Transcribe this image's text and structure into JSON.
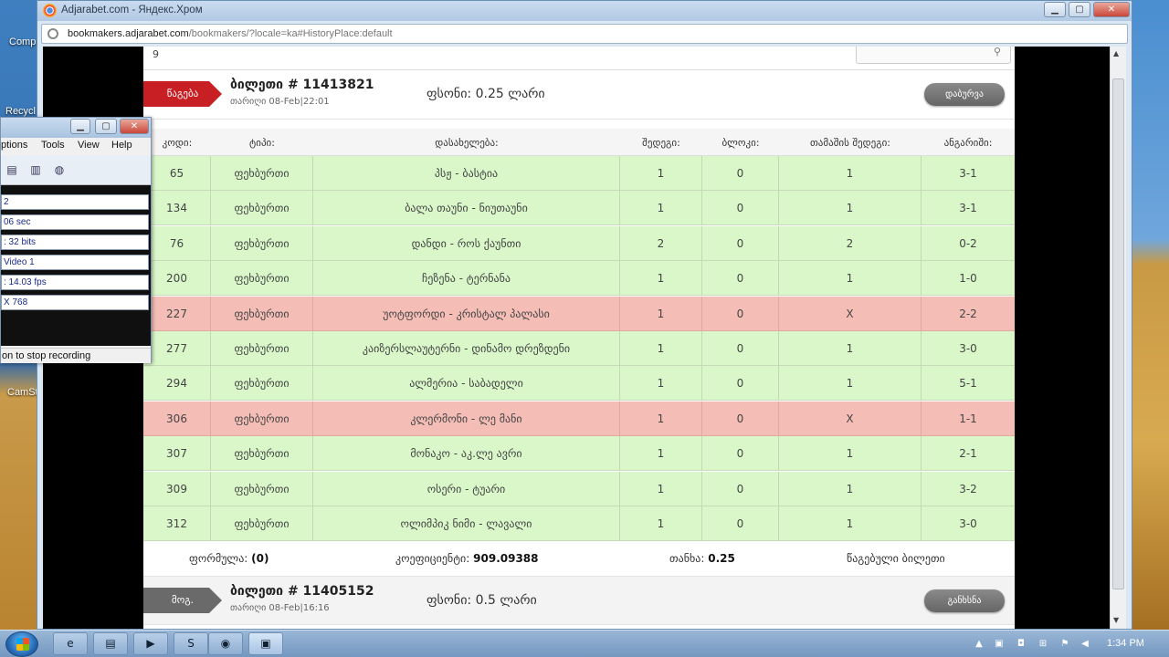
{
  "browser": {
    "title": "Adjarabet.com - Яндекс.Хром",
    "url_host": "bookmakers.adjarabet.com",
    "url_path": "/bookmakers/?locale=ka#HistoryPlace:default",
    "controls": {
      "minimize": "▁",
      "maximize": "▢",
      "close": "✕"
    }
  },
  "desktop": {
    "icons": [
      {
        "label": "Comp"
      },
      {
        "label": "Recycl"
      },
      {
        "label": "CamSt"
      }
    ]
  },
  "page": {
    "top_number": "9",
    "tickets": [
      {
        "status_label": "წაგება",
        "status": "lost",
        "title": "ბილეთი # 11413821",
        "date": "თარიღი 08-Feb|22:01",
        "stake": "ფსონი: 0.25 ლარი",
        "button": "დაბურვა"
      },
      {
        "status_label": "მოგ.",
        "status": "won",
        "title": "ბილეთი # 11405152",
        "date": "თარიღი 08-Feb|16:16",
        "stake": "ფსონი: 0.5 ლარი",
        "button": "განხსნა"
      }
    ],
    "columns": [
      "კოდი:",
      "ტიპი:",
      "დასახელება:",
      "შედეგი:",
      "ბლოკი:",
      "თამაშის შედეგი:",
      "ანგარიში:"
    ],
    "rows": [
      {
        "code": "65",
        "type": "ფეხბურთი",
        "name": "პსჟ - ბასტია",
        "result": "1",
        "block": "0",
        "game_result": "1",
        "score": "3-1",
        "status": "won"
      },
      {
        "code": "134",
        "type": "ფეხბურთი",
        "name": "ბალა თაუნი - ნიუთაუნი",
        "result": "1",
        "block": "0",
        "game_result": "1",
        "score": "3-1",
        "status": "won"
      },
      {
        "code": "76",
        "type": "ფეხბურთი",
        "name": "დანდი - როს ქაუნთი",
        "result": "2",
        "block": "0",
        "game_result": "2",
        "score": "0-2",
        "status": "won"
      },
      {
        "code": "200",
        "type": "ფეხბურთი",
        "name": "ჩეზენა - ტერნანა",
        "result": "1",
        "block": "0",
        "game_result": "1",
        "score": "1-0",
        "status": "won"
      },
      {
        "code": "227",
        "type": "ფეხბურთი",
        "name": "უოტფორდი - კრისტალ პალასი",
        "result": "1",
        "block": "0",
        "game_result": "X",
        "score": "2-2",
        "status": "lost"
      },
      {
        "code": "277",
        "type": "ფეხბურთი",
        "name": "კაიზერსლაუტერნი - დინამო დრეზდენი",
        "result": "1",
        "block": "0",
        "game_result": "1",
        "score": "3-0",
        "status": "won"
      },
      {
        "code": "294",
        "type": "ფეხბურთი",
        "name": "ალმერია - საბადელი",
        "result": "1",
        "block": "0",
        "game_result": "1",
        "score": "5-1",
        "status": "won"
      },
      {
        "code": "306",
        "type": "ფეხბურთი",
        "name": "კლერმონი - ლე მანი",
        "result": "1",
        "block": "0",
        "game_result": "X",
        "score": "1-1",
        "status": "lost"
      },
      {
        "code": "307",
        "type": "ფეხბურთი",
        "name": "მონაკო - აკ.ლე ავრი",
        "result": "1",
        "block": "0",
        "game_result": "1",
        "score": "2-1",
        "status": "won"
      },
      {
        "code": "309",
        "type": "ფეხბურთი",
        "name": "ოსერი - ტუარი",
        "result": "1",
        "block": "0",
        "game_result": "1",
        "score": "3-2",
        "status": "won"
      },
      {
        "code": "312",
        "type": "ფეხბურთი",
        "name": "ოლიმპიკ ნიმი - ლავალი",
        "result": "1",
        "block": "0",
        "game_result": "1",
        "score": "3-0",
        "status": "won"
      }
    ],
    "summary": {
      "formula_label": "ფორმულა:",
      "formula_value": "(0)",
      "coef_label": "კოეფიციენტი:",
      "coef_value": "909.09388",
      "amount_label": "თანხა:",
      "amount_value": "0.25",
      "status_text": "წაგებული ბილეთი"
    }
  },
  "recorder": {
    "menu": [
      "ptions",
      "Tools",
      "View",
      "Help"
    ],
    "fields": [
      "2",
      "06 sec",
      ": 32 bits",
      "Video 1",
      ": 14.03 fps",
      "X 768"
    ],
    "status": "on to stop recording"
  },
  "taskbar": {
    "time": "1:34 PM",
    "apps": [
      {
        "icon": "e",
        "name": "ie"
      },
      {
        "icon": "▤",
        "name": "explorer"
      },
      {
        "icon": "▶",
        "name": "media-player"
      },
      {
        "icon": "S",
        "name": "skype"
      },
      {
        "icon": "◉",
        "name": "browser"
      },
      {
        "icon": "▣",
        "name": "recorder"
      }
    ]
  }
}
